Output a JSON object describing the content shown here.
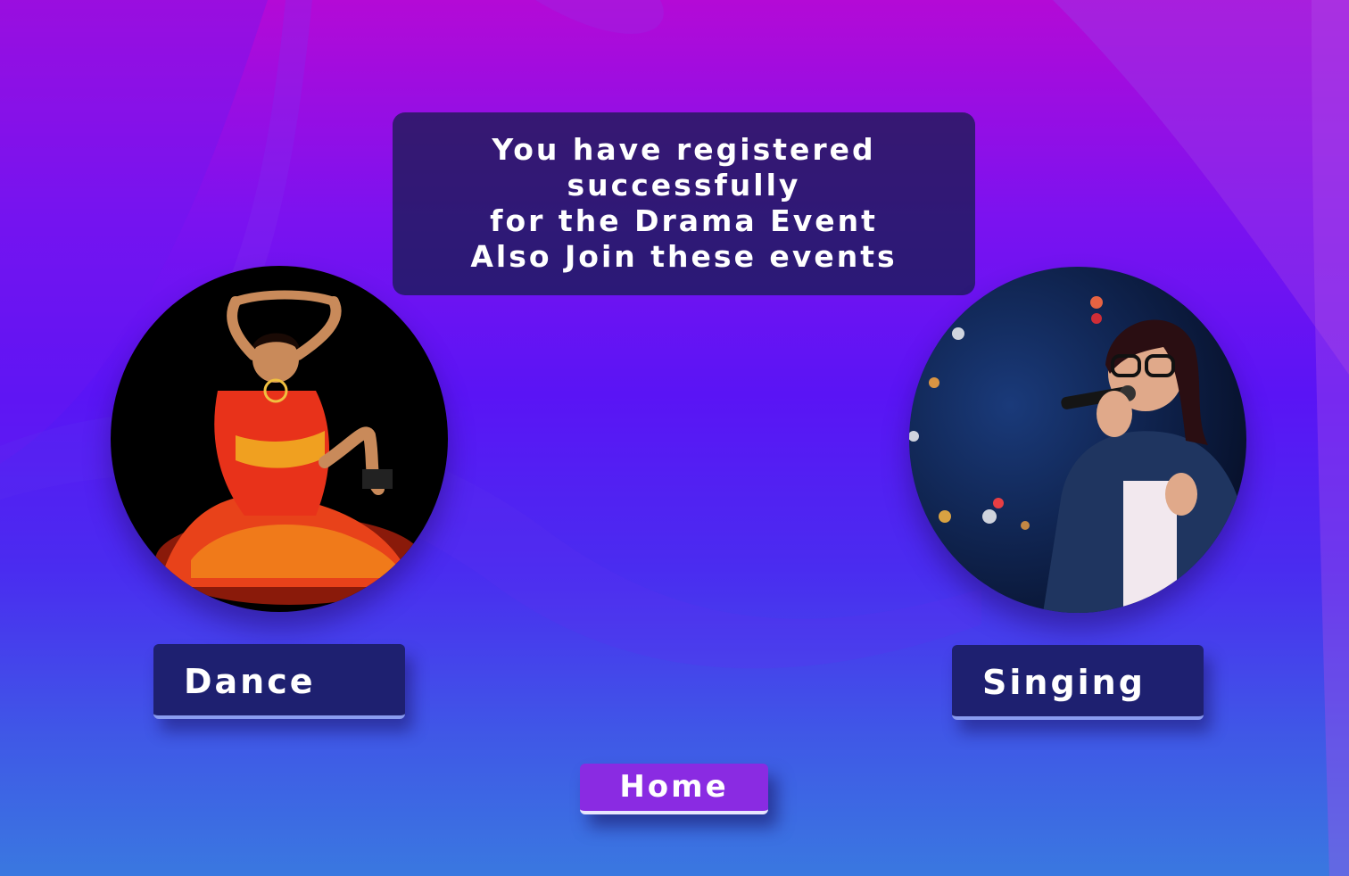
{
  "message": {
    "line1": "You have registered",
    "line2": "successfully",
    "line3": "for the Drama Event",
    "line4": "Also Join these events"
  },
  "events": {
    "dance": {
      "label": "Dance",
      "image": "dancer-photo"
    },
    "singing": {
      "label": "Singing",
      "image": "singer-photo"
    }
  },
  "home": {
    "label": "Home"
  },
  "colors": {
    "background_top": "#b40ad6",
    "background_bottom": "#3a78e0",
    "message_box": "#121c46",
    "event_button": "#1e2070",
    "home_button": "#8a2be2"
  }
}
